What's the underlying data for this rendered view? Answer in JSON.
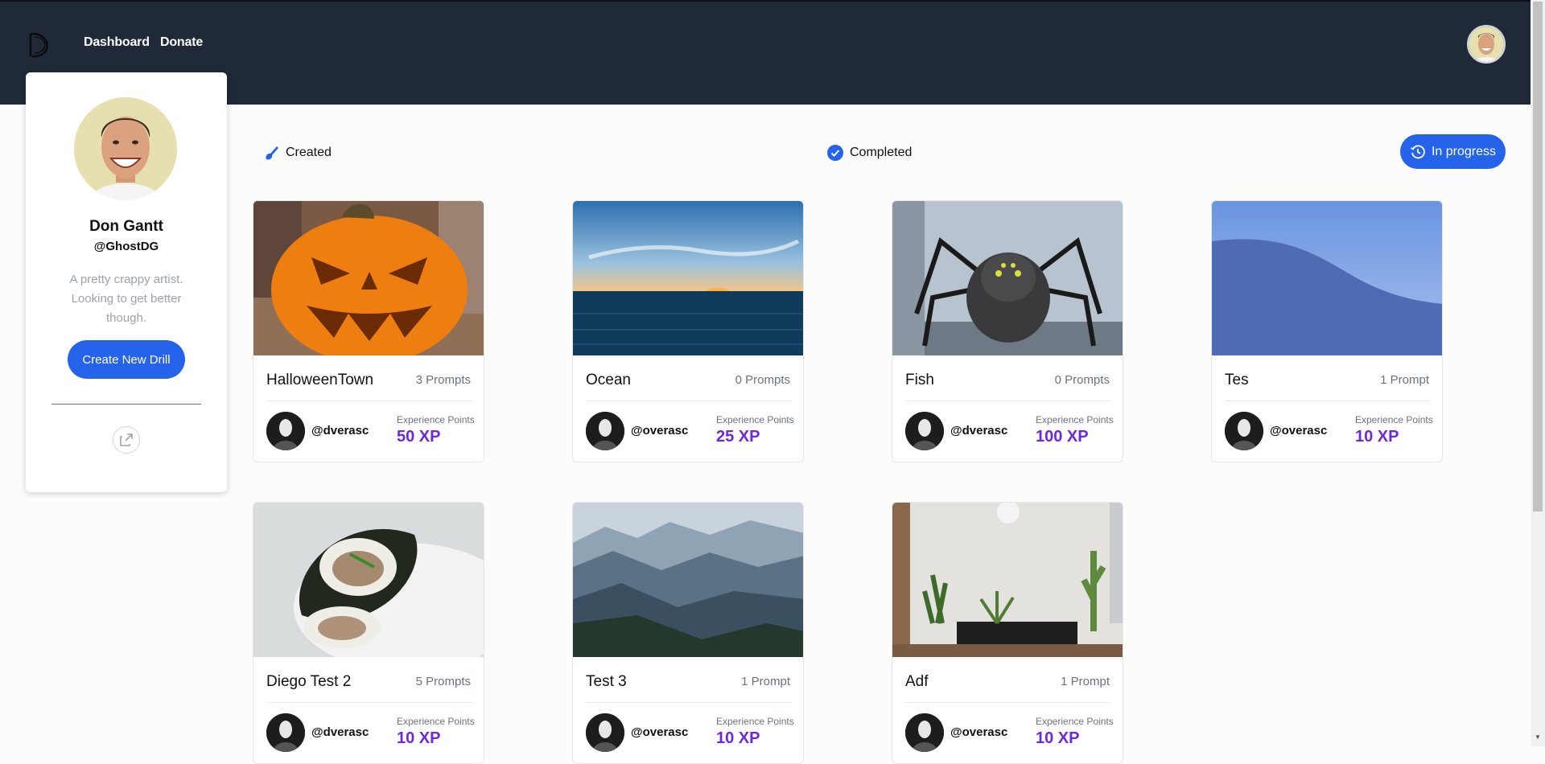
{
  "nav": {
    "links": [
      "Dashboard",
      "Donate"
    ]
  },
  "profile": {
    "name": "Don Gantt",
    "handle": "@GhostDG",
    "bio": "A pretty crappy artist. Looking to get better though.",
    "create_label": "Create New Drill"
  },
  "tabs": {
    "created": "Created",
    "completed": "Completed",
    "in_progress": "In progress"
  },
  "cards": [
    {
      "title": "HalloweenTown",
      "prompts": "3 Prompts",
      "user": "@dverasc",
      "xp_label": "Experience Points",
      "xp": "50 XP",
      "image": "jack-o-lantern"
    },
    {
      "title": "Ocean",
      "prompts": "0 Prompts",
      "user": "@overasc",
      "xp_label": "Experience Points",
      "xp": "25 XP",
      "image": "ocean-sunset"
    },
    {
      "title": "Fish",
      "prompts": "0 Prompts",
      "user": "@dverasc",
      "xp_label": "Experience Points",
      "xp": "100 XP",
      "image": "spider-cat"
    },
    {
      "title": "Tes",
      "prompts": "1 Prompt",
      "user": "@overasc",
      "xp_label": "Experience Points",
      "xp": "10 XP",
      "image": "blue-hill"
    },
    {
      "title": "Diego Test 2",
      "prompts": "5 Prompts",
      "user": "@dverasc",
      "xp_label": "Experience Points",
      "xp": "10 XP",
      "image": "burrito"
    },
    {
      "title": "Test 3",
      "prompts": "1 Prompt",
      "user": "@overasc",
      "xp_label": "Experience Points",
      "xp": "10 XP",
      "image": "mountains"
    },
    {
      "title": "Adf",
      "prompts": "1 Prompt",
      "user": "@overasc",
      "xp_label": "Experience Points",
      "xp": "10 XP",
      "image": "living-room"
    }
  ],
  "colors": {
    "header": "#1f2937",
    "accent": "#2563eb",
    "xp": "#6d28d9"
  }
}
